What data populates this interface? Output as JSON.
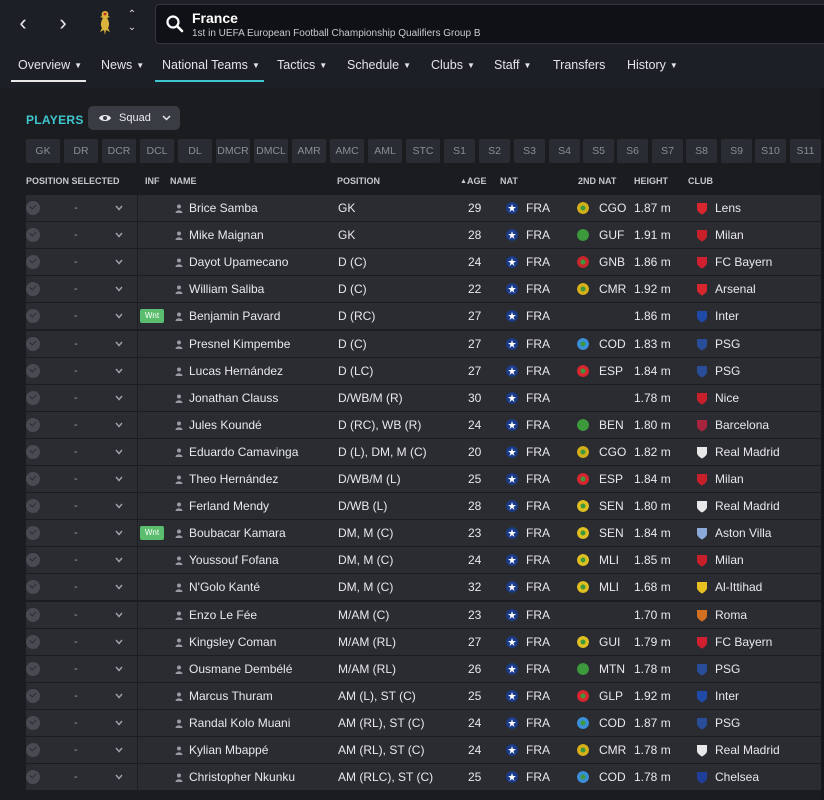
{
  "header": {
    "team_name": "France",
    "subtitle": "1st in UEFA European Football Championship Qualifiers Group B"
  },
  "nav": {
    "back": "‹",
    "forward": "›",
    "up": "⌃",
    "down": "⌄"
  },
  "menu": [
    {
      "label": "Overview",
      "chevron": true
    },
    {
      "label": "News",
      "chevron": true
    },
    {
      "label": "National Teams",
      "chevron": true
    },
    {
      "label": "Tactics",
      "chevron": true
    },
    {
      "label": "Schedule",
      "chevron": true
    },
    {
      "label": "Clubs",
      "chevron": true
    },
    {
      "label": "Staff",
      "chevron": true
    },
    {
      "label": "Transfers",
      "chevron": false
    },
    {
      "label": "History",
      "chevron": true
    }
  ],
  "players_section": {
    "title": "PLAYERS",
    "view_label": "Squad"
  },
  "position_filters": [
    "GK",
    "DR",
    "DCR",
    "DCL",
    "DL",
    "DMCR",
    "DMCL",
    "AMR",
    "AMC",
    "AML",
    "STC",
    "S1",
    "S2",
    "S3",
    "S4",
    "S5",
    "S6",
    "S7",
    "S8",
    "S9",
    "S10",
    "S11"
  ],
  "columns": {
    "position_selected": "POSITION SELECTED",
    "inf": "INF",
    "name": "NAME",
    "position": "POSITION",
    "age": "AGE",
    "nat": "NAT",
    "second_nat": "2ND NAT",
    "height": "HEIGHT",
    "club": "CLUB",
    "sort_indicator": "▲"
  },
  "colors": {
    "accent": "#3ec7cf",
    "badge": "#5bbd6e",
    "row_bg": "#2b2c32",
    "page_bg": "#1b1c20"
  },
  "players": [
    {
      "selected": "-",
      "inf": "",
      "name": "Brice Samba",
      "position": "GK",
      "age": "29",
      "nat": "FRA",
      "nat2": "CGO",
      "height": "1.87 m",
      "club": "Lens",
      "nat2_color": "#d4b018",
      "club_color": "#d8262e"
    },
    {
      "selected": "-",
      "inf": "",
      "name": "Mike Maignan",
      "position": "GK",
      "age": "28",
      "nat": "FRA",
      "nat2": "GUF",
      "height": "1.91 m",
      "club": "Milan",
      "nat2_color": "#3c9a3c",
      "club_color": "#c8202a"
    },
    {
      "selected": "-",
      "inf": "",
      "name": "Dayot Upamecano",
      "position": "D (C)",
      "age": "24",
      "nat": "FRA",
      "nat2": "GNB",
      "height": "1.86 m",
      "club": "FC Bayern",
      "nat2_color": "#c8262a",
      "club_color": "#d02030"
    },
    {
      "selected": "-",
      "inf": "",
      "name": "William Saliba",
      "position": "D (C)",
      "age": "22",
      "nat": "FRA",
      "nat2": "CMR",
      "height": "1.92 m",
      "club": "Arsenal",
      "nat2_color": "#d8b018",
      "club_color": "#d8262e"
    },
    {
      "selected": "-",
      "inf": "Wnt",
      "name": "Benjamin Pavard",
      "position": "D (RC)",
      "age": "27",
      "nat": "FRA",
      "nat2": "",
      "height": "1.86 m",
      "club": "Inter",
      "nat2_color": "",
      "club_color": "#1f4aa8"
    },
    {
      "selected": "-",
      "inf": "",
      "name": "Presnel Kimpembe",
      "position": "D (C)",
      "age": "27",
      "nat": "FRA",
      "nat2": "COD",
      "height": "1.83 m",
      "club": "PSG",
      "nat2_color": "#3a8fd8",
      "club_color": "#2a4d9a"
    },
    {
      "selected": "-",
      "inf": "",
      "name": "Lucas Hernández",
      "position": "D (LC)",
      "age": "27",
      "nat": "FRA",
      "nat2": "ESP",
      "height": "1.84 m",
      "club": "PSG",
      "nat2_color": "#d8262e",
      "club_color": "#2a4d9a"
    },
    {
      "selected": "-",
      "inf": "",
      "name": "Jonathan Clauss",
      "position": "D/WB/M (R)",
      "age": "30",
      "nat": "FRA",
      "nat2": "",
      "height": "1.78 m",
      "club": "Nice",
      "nat2_color": "",
      "club_color": "#c8202a"
    },
    {
      "selected": "-",
      "inf": "",
      "name": "Jules Koundé",
      "position": "D (RC), WB (R)",
      "age": "24",
      "nat": "FRA",
      "nat2": "BEN",
      "height": "1.80 m",
      "club": "Barcelona",
      "nat2_color": "#3c9a3c",
      "club_color": "#a6243e"
    },
    {
      "selected": "-",
      "inf": "",
      "name": "Eduardo Camavinga",
      "position": "D (L), DM, M (C)",
      "age": "20",
      "nat": "FRA",
      "nat2": "CGO",
      "height": "1.82 m",
      "club": "Real Madrid",
      "nat2_color": "#d4b018",
      "club_color": "#e8e8e8"
    },
    {
      "selected": "-",
      "inf": "",
      "name": "Theo Hernández",
      "position": "D/WB/M (L)",
      "age": "25",
      "nat": "FRA",
      "nat2": "ESP",
      "height": "1.84 m",
      "club": "Milan",
      "nat2_color": "#d8262e",
      "club_color": "#c8202a"
    },
    {
      "selected": "-",
      "inf": "",
      "name": "Ferland Mendy",
      "position": "D/WB (L)",
      "age": "28",
      "nat": "FRA",
      "nat2": "SEN",
      "height": "1.80 m",
      "club": "Real Madrid",
      "nat2_color": "#e0c020",
      "club_color": "#e8e8e8"
    },
    {
      "selected": "-",
      "inf": "Wnt",
      "name": "Boubacar Kamara",
      "position": "DM, M (C)",
      "age": "23",
      "nat": "FRA",
      "nat2": "SEN",
      "height": "1.84 m",
      "club": "Aston Villa",
      "nat2_color": "#e0c020",
      "club_color": "#8aa8d8"
    },
    {
      "selected": "-",
      "inf": "",
      "name": "Youssouf Fofana",
      "position": "DM, M (C)",
      "age": "24",
      "nat": "FRA",
      "nat2": "MLI",
      "height": "1.85 m",
      "club": "Milan",
      "nat2_color": "#e0c020",
      "club_color": "#c8202a"
    },
    {
      "selected": "-",
      "inf": "",
      "name": "N'Golo Kanté",
      "position": "DM, M (C)",
      "age": "32",
      "nat": "FRA",
      "nat2": "MLI",
      "height": "1.68 m",
      "club": "Al-Ittihad",
      "nat2_color": "#e0c020",
      "club_color": "#e8c020"
    },
    {
      "selected": "-",
      "inf": "",
      "name": "Enzo Le Fée",
      "position": "M/AM (C)",
      "age": "23",
      "nat": "FRA",
      "nat2": "",
      "height": "1.70 m",
      "club": "Roma",
      "nat2_color": "",
      "club_color": "#d07020"
    },
    {
      "selected": "-",
      "inf": "",
      "name": "Kingsley Coman",
      "position": "M/AM (RL)",
      "age": "27",
      "nat": "FRA",
      "nat2": "GUI",
      "height": "1.79 m",
      "club": "FC Bayern",
      "nat2_color": "#e0c020",
      "club_color": "#d02030"
    },
    {
      "selected": "-",
      "inf": "",
      "name": "Ousmane Dembélé",
      "position": "M/AM (RL)",
      "age": "26",
      "nat": "FRA",
      "nat2": "MTN",
      "height": "1.78 m",
      "club": "PSG",
      "nat2_color": "#3c9a3c",
      "club_color": "#2a4d9a"
    },
    {
      "selected": "-",
      "inf": "",
      "name": "Marcus Thuram",
      "position": "AM (L), ST (C)",
      "age": "25",
      "nat": "FRA",
      "nat2": "GLP",
      "height": "1.92 m",
      "club": "Inter",
      "nat2_color": "#d8262e",
      "club_color": "#1f4aa8"
    },
    {
      "selected": "-",
      "inf": "",
      "name": "Randal Kolo Muani",
      "position": "AM (RL), ST (C)",
      "age": "24",
      "nat": "FRA",
      "nat2": "COD",
      "height": "1.87 m",
      "club": "PSG",
      "nat2_color": "#3a8fd8",
      "club_color": "#2a4d9a"
    },
    {
      "selected": "-",
      "inf": "",
      "name": "Kylian Mbappé",
      "position": "AM (RL), ST (C)",
      "age": "24",
      "nat": "FRA",
      "nat2": "CMR",
      "height": "1.78 m",
      "club": "Real Madrid",
      "nat2_color": "#d8b018",
      "club_color": "#e8e8e8"
    },
    {
      "selected": "-",
      "inf": "",
      "name": "Christopher Nkunku",
      "position": "AM (RLC), ST (C)",
      "age": "25",
      "nat": "FRA",
      "nat2": "COD",
      "height": "1.78 m",
      "club": "Chelsea",
      "nat2_color": "#3a8fd8",
      "club_color": "#1f3f9a"
    }
  ]
}
